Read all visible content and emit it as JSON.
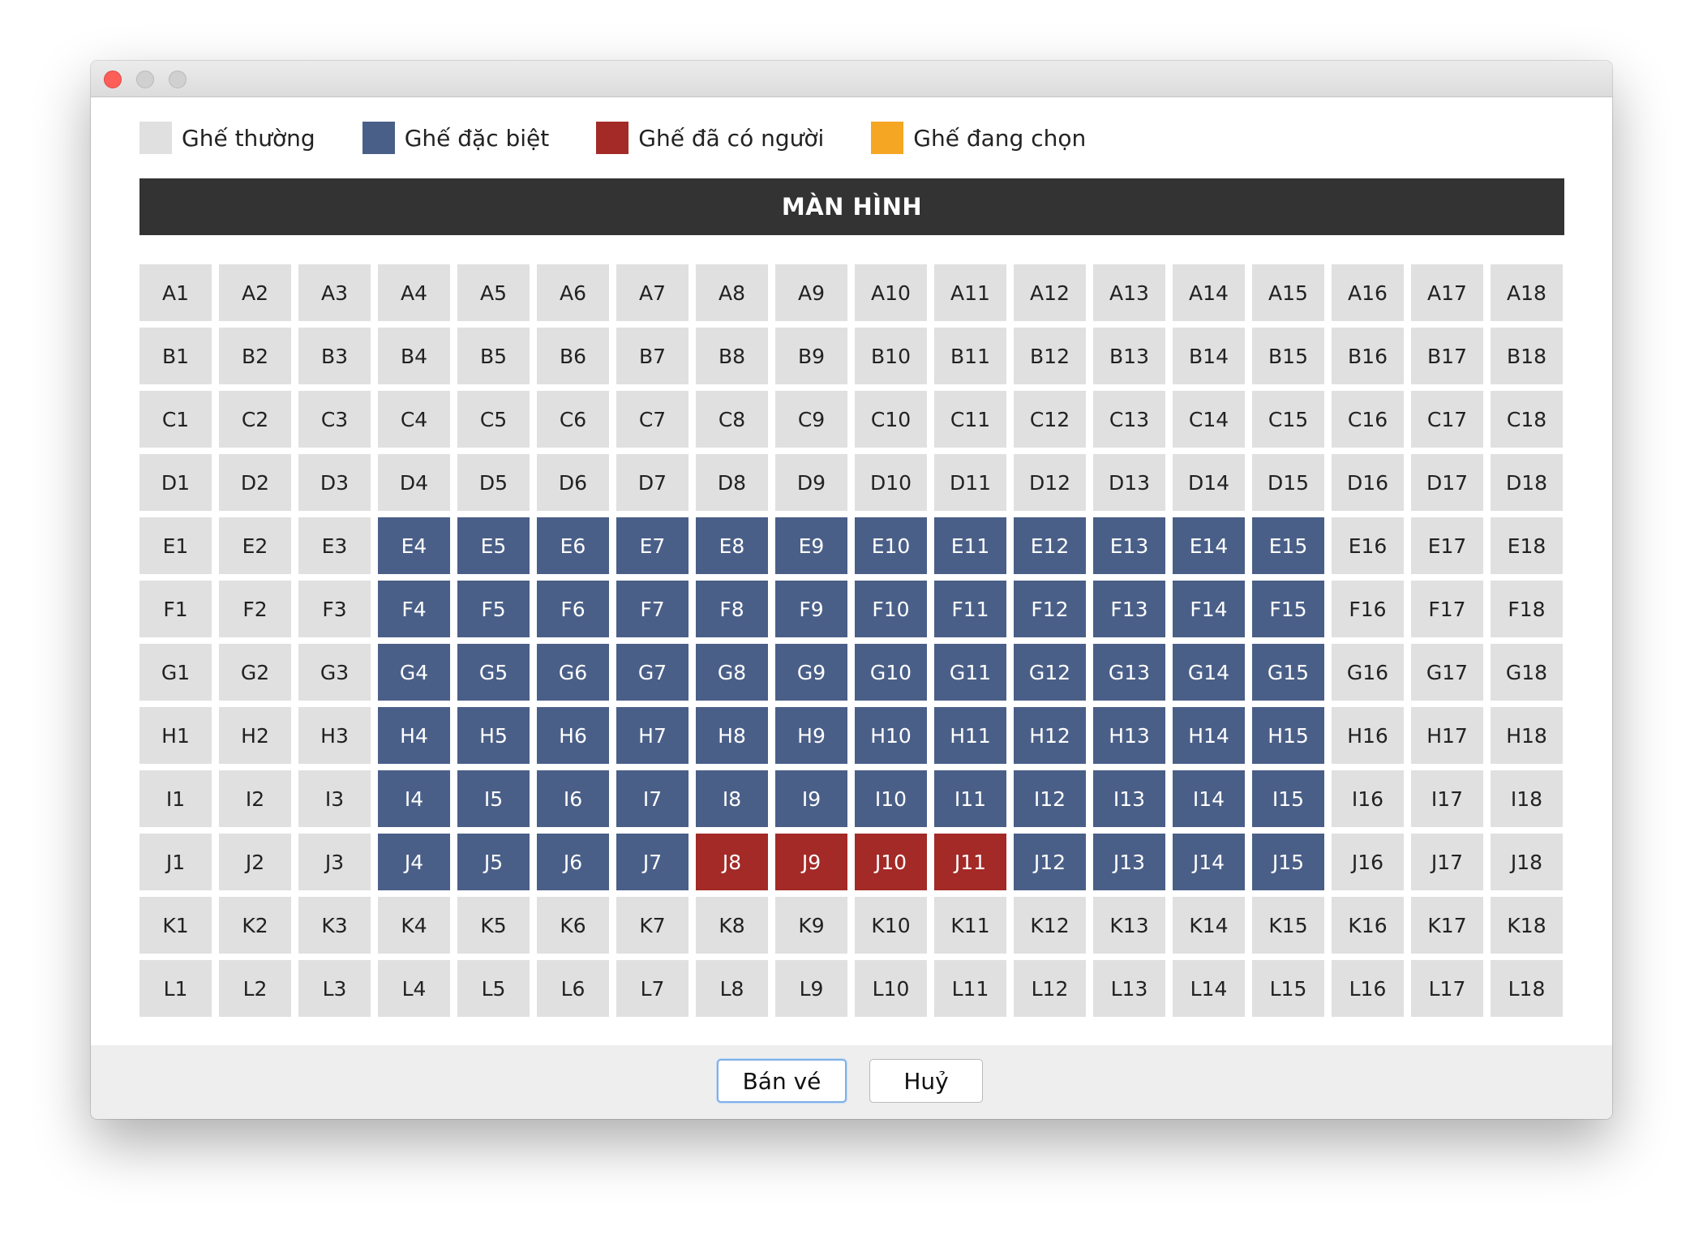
{
  "legend": [
    {
      "label": "Ghế thường",
      "color": "#e0e0e0"
    },
    {
      "label": "Ghế đặc biệt",
      "color": "#4a5f88"
    },
    {
      "label": "Ghế đã có người",
      "color": "#a32a27"
    },
    {
      "label": "Ghế đang chọn",
      "color": "#f5a623"
    }
  ],
  "screen_label": "MÀN HÌNH",
  "seat_colors": {
    "normal": "#e0e0e0",
    "special": "#4a5f88",
    "occupied": "#a32a27",
    "selected": "#f5a623"
  },
  "seat_text_colors": {
    "normal": "#222222",
    "special": "#ffffff",
    "occupied": "#ffffff",
    "selected": "#ffffff"
  },
  "seats": {
    "rows": [
      "A",
      "B",
      "C",
      "D",
      "E",
      "F",
      "G",
      "H",
      "I",
      "J",
      "K",
      "L"
    ],
    "columns": 18,
    "special": {
      "rows": [
        "E",
        "F",
        "G",
        "H",
        "I",
        "J"
      ],
      "from": 4,
      "to": 15
    },
    "occupied": [
      "J8",
      "J9",
      "J10",
      "J11"
    ],
    "selected": []
  },
  "buttons": {
    "sell": "Bán vé",
    "cancel": "Huỷ"
  }
}
